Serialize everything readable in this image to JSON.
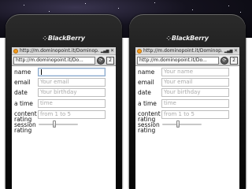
{
  "brand": "BlackBerry",
  "phones": [
    {
      "status_title": "http://m.dominopoint.it/Dominop...",
      "url": "http://m.dominopoint.it/Do...",
      "form": {
        "name_label": "name",
        "name_value": "",
        "name_placeholder": "",
        "email_label": "email",
        "email_placeholder": "Your email",
        "date_label": "date",
        "date_placeholder": "Your birthday",
        "time_label": "a time",
        "time_placeholder": "time",
        "content_label_1": "content",
        "content_label_2": "rating",
        "content_placeholder": "from 1 to 5",
        "session_label_1": "session",
        "session_label_2": "rating",
        "session_value": 0.4
      }
    },
    {
      "status_title": "http://m.dominopoint.it/Dominop...",
      "url": "http://m.dominopoint.it/Do...",
      "form": {
        "name_label": "name",
        "name_placeholder": "Your name",
        "email_label": "email",
        "email_placeholder": "Your email",
        "date_label": "date",
        "date_placeholder": "Your birthday",
        "time_label": "a time",
        "time_placeholder": "time",
        "content_label_1": "content",
        "content_label_2": "rating",
        "content_placeholder": "from 1 to 5",
        "session_label_1": "session",
        "session_label_2": "rating",
        "session_value": 0.4
      }
    }
  ],
  "icons": {
    "site": "site-favicon-icon",
    "signal": "signal-strength-icon",
    "close": "close-icon",
    "refresh": "refresh-icon",
    "tabs": "tabs-icon"
  },
  "colors": {
    "accent_favicon": "#f29a1b",
    "focused_border": "#8aa7c9"
  }
}
